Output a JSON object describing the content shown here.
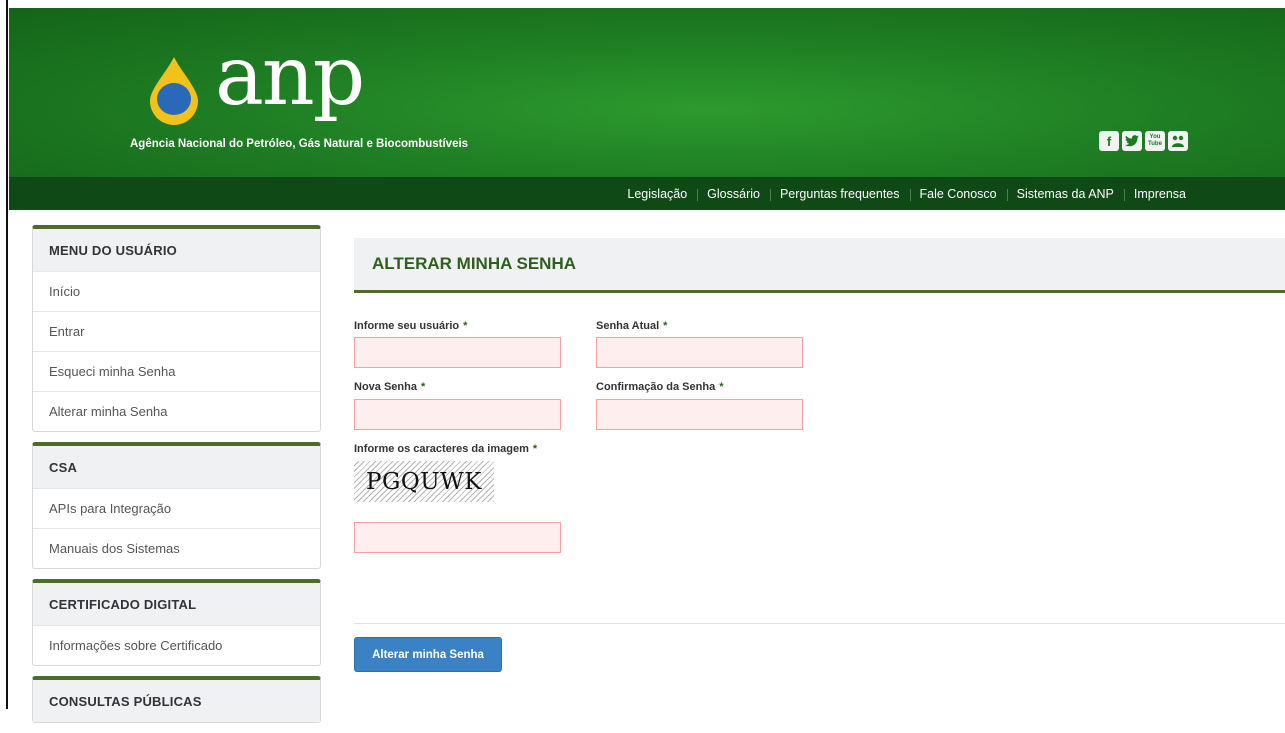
{
  "header": {
    "logo_text": "anp",
    "subtitle": "Agência Nacional do Petróleo, Gás Natural e Biocombustíveis",
    "social": [
      "facebook",
      "twitter",
      "youtube",
      "other"
    ]
  },
  "nav": {
    "items": [
      "Legislação",
      "Glossário",
      "Perguntas frequentes",
      "Fale Conosco",
      "Sistemas da ANP",
      "Imprensa"
    ]
  },
  "sidebar": {
    "panels": [
      {
        "title": "MENU DO USUÁRIO",
        "items": [
          "Início",
          "Entrar",
          "Esqueci minha Senha",
          "Alterar minha Senha"
        ]
      },
      {
        "title": "CSA",
        "items": [
          "APIs para Integração",
          "Manuais dos Sistemas"
        ]
      },
      {
        "title": "CERTIFICADO DIGITAL",
        "items": [
          "Informações sobre Certificado"
        ]
      },
      {
        "title": "CONSULTAS PÚBLICAS",
        "items": []
      }
    ]
  },
  "main": {
    "title": "ALTERAR MINHA SENHA",
    "required_mark": "*",
    "fields": {
      "usuario_label": "Informe seu usuário",
      "senha_atual_label": "Senha Atual",
      "nova_senha_label": "Nova Senha",
      "confirmacao_label": "Confirmação da Senha",
      "captcha_label": "Informe os caracteres da imagem"
    },
    "captcha_text": "PGQUWK",
    "submit_label": "Alterar minha Senha"
  },
  "colors": {
    "header_green": "#1f7f24",
    "nav_dark_green": "#0f4a16",
    "accent_olive": "#4f6b2a",
    "button_blue": "#3b82c4",
    "field_error_bg": "#ffeeee"
  }
}
